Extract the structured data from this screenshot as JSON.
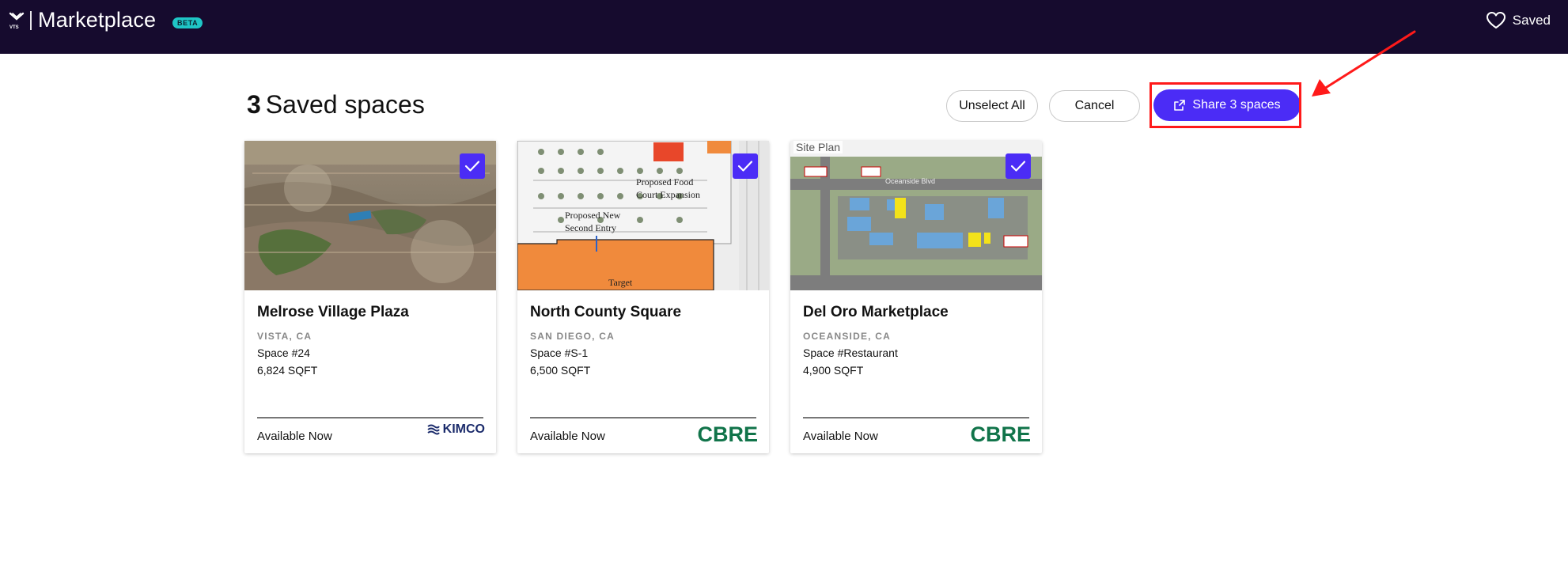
{
  "topbar": {
    "brand": "Marketplace",
    "badge": "BETA",
    "saved_label": "Saved",
    "logo_icon": "vts-logo-icon"
  },
  "header": {
    "count": "3",
    "title": "Saved spaces",
    "unselect_label": "Unselect All",
    "cancel_label": "Cancel",
    "share_label": "Share 3 spaces"
  },
  "colors": {
    "topbar_bg": "#160b2e",
    "primary": "#4b2cf6",
    "annotation": "#ff1a1a",
    "badge": "#1fc6c6",
    "cbre_green": "#11744a",
    "kimco_navy": "#1b2b6b"
  },
  "cards": [
    {
      "name": "Melrose Village Plaza",
      "location": "VISTA, CA",
      "space": "Space #24",
      "sqft": "6,824 SQFT",
      "availability": "Available Now",
      "broker": "KIMCO",
      "selected": true,
      "image_kind": "aerial-photo"
    },
    {
      "name": "North County Square",
      "location": "SAN DIEGO, CA",
      "space": "Space #S-1",
      "sqft": "6,500 SQFT",
      "availability": "Available Now",
      "broker": "CBRE",
      "selected": true,
      "image_kind": "site-plan-drawing",
      "image_labels": [
        "Proposed Food",
        "Court Expansion",
        "Proposed New",
        "Second Entry",
        "Target"
      ]
    },
    {
      "name": "Del Oro Marketplace",
      "location": "OCEANSIDE, CA",
      "space": "Space #Restaurant",
      "sqft": "4,900 SQFT",
      "availability": "Available Now",
      "broker": "CBRE",
      "selected": true,
      "image_kind": "site-plan-map",
      "image_labels": [
        "Site Plan",
        "Oceanside Blvd"
      ]
    }
  ]
}
